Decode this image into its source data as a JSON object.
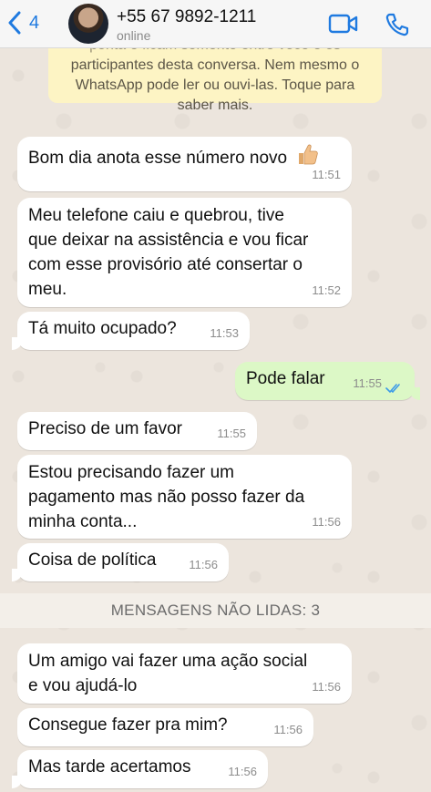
{
  "header": {
    "back_count": "4",
    "contact_name": "+55 67 9892-1211",
    "status": "online"
  },
  "notice": {
    "line1": "ponta e ficam somente entre você e os",
    "line2": "participantes desta conversa. Nem mesmo o",
    "line3": "WhatsApp pode ler ou ouvi-las. Toque para",
    "line4": "saber mais."
  },
  "messages": [
    {
      "direction": "in",
      "text": "Bom dia anota esse número novo",
      "emoji": "thumbs-up",
      "time": "11:51"
    },
    {
      "direction": "in",
      "lines": [
        "Meu telefone caiu e quebrou, tive",
        "que deixar na assistência e vou ficar",
        "com esse provisório até consertar o",
        "meu."
      ],
      "time": "11:52"
    },
    {
      "direction": "in",
      "text": "Tá muito ocupado?",
      "time": "11:53"
    },
    {
      "direction": "out",
      "text": "Pode falar",
      "time": "11:55",
      "status": "read"
    },
    {
      "direction": "in",
      "text": "Preciso de um favor",
      "time": "11:55"
    },
    {
      "direction": "in",
      "lines": [
        "Estou precisando fazer um",
        "pagamento mas não posso fazer da",
        "minha conta..."
      ],
      "time": "11:56"
    },
    {
      "direction": "in",
      "text": "Coisa de política",
      "time": "11:56"
    },
    {
      "direction": "in",
      "lines": [
        "Um amigo vai fazer uma ação social",
        "e vou ajudá-lo"
      ],
      "time": "11:56"
    },
    {
      "direction": "in",
      "text": "Consegue fazer pra mim?",
      "time": "11:56"
    },
    {
      "direction": "in",
      "text": "Mas tarde acertamos",
      "time": "11:56"
    }
  ],
  "unread_label": "MENSAGENS NÃO LIDAS: 3",
  "colors": {
    "accent": "#1f7ae0",
    "incoming_bubble": "#ffffff",
    "outgoing_bubble": "#dcf8c6",
    "notice_bg": "#fdf4c4",
    "chat_bg": "#ece5dd",
    "read_ticks": "#3b9ae8"
  },
  "icons": [
    "chevron-left-icon",
    "video-call-icon",
    "phone-icon",
    "thumbs-up-icon",
    "double-check-icon"
  ]
}
